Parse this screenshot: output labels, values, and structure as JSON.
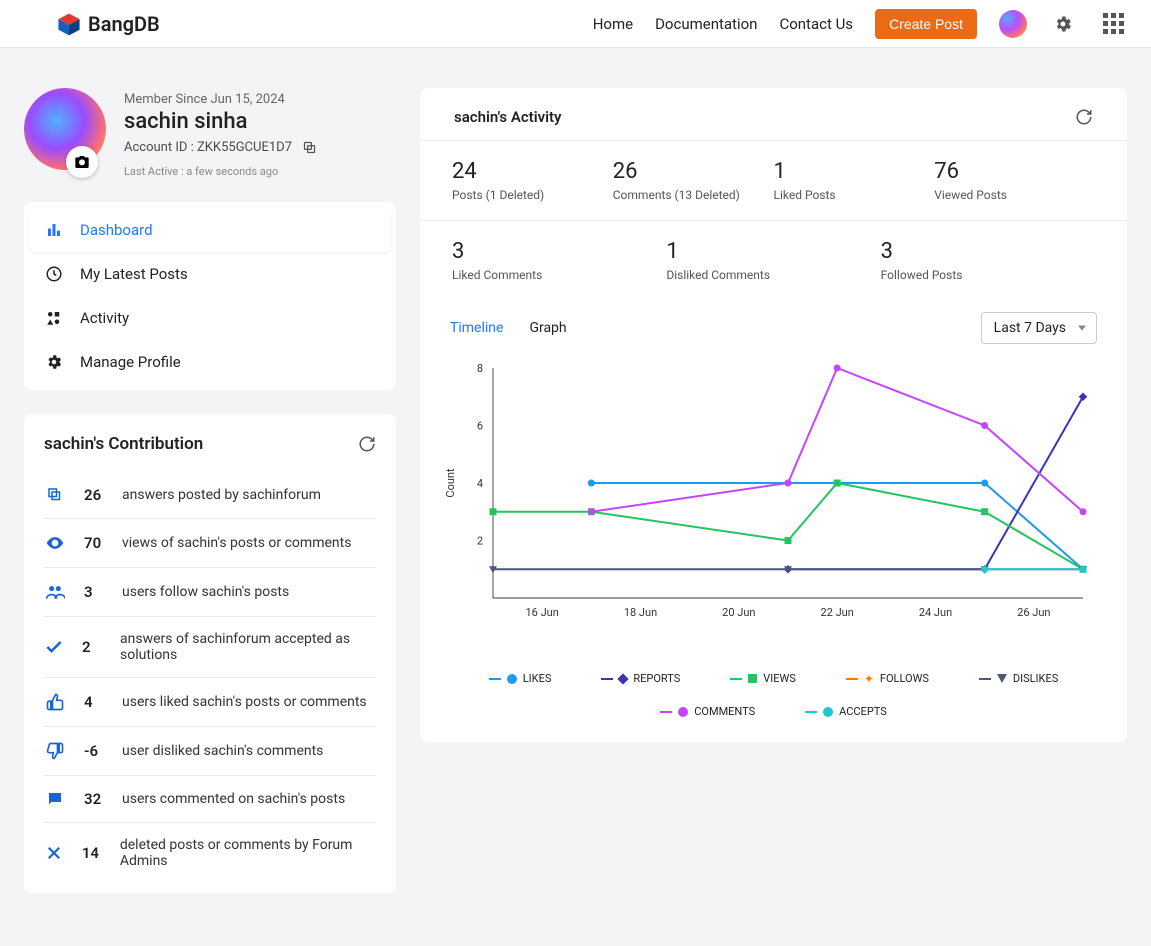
{
  "brand": "BangDB",
  "topnav": {
    "home": "Home",
    "docs": "Documentation",
    "contact": "Contact Us",
    "create": "Create Post"
  },
  "profile": {
    "member_since": "Member Since Jun 15, 2024",
    "name": "sachin sinha",
    "account_label": "Account ID : ZKK55GCUE1D7",
    "last_active": "Last Active : a few seconds ago"
  },
  "sidebar": {
    "items": [
      {
        "label": "Dashboard"
      },
      {
        "label": "My Latest Posts"
      },
      {
        "label": "Activity"
      },
      {
        "label": "Manage Profile"
      }
    ]
  },
  "contribution": {
    "title": "sachin's Contribution",
    "rows": [
      {
        "n": "26",
        "txt": "answers posted by sachinforum"
      },
      {
        "n": "70",
        "txt": "views of sachin's posts or comments"
      },
      {
        "n": "3",
        "txt": "users follow sachin's posts"
      },
      {
        "n": "2",
        "txt": "answers of sachinforum accepted as solutions"
      },
      {
        "n": "4",
        "txt": "users liked sachin's posts or comments"
      },
      {
        "n": "-6",
        "txt": "user disliked sachin's comments"
      },
      {
        "n": "32",
        "txt": "users commented on sachin's posts"
      },
      {
        "n": "14",
        "txt": "deleted posts or comments by Forum Admins"
      }
    ]
  },
  "activity": {
    "title": "sachin's Activity",
    "stats_top": [
      {
        "val": "24",
        "lbl": "Posts (1 Deleted)"
      },
      {
        "val": "26",
        "lbl": "Comments (13 Deleted)"
      },
      {
        "val": "1",
        "lbl": "Liked Posts"
      },
      {
        "val": "76",
        "lbl": "Viewed Posts"
      }
    ],
    "stats_bottom": [
      {
        "val": "3",
        "lbl": "Liked Comments"
      },
      {
        "val": "1",
        "lbl": "Disliked Comments"
      },
      {
        "val": "3",
        "lbl": "Followed Posts"
      }
    ],
    "tabs": {
      "timeline": "Timeline",
      "graph": "Graph"
    },
    "range": "Last 7 Days"
  },
  "chart_data": {
    "type": "line",
    "xlabel": "",
    "ylabel": "Count",
    "ylim": [
      0,
      8
    ],
    "x_ticks": [
      "16 Jun",
      "18 Jun",
      "20 Jun",
      "22 Jun",
      "24 Jun",
      "26 Jun"
    ],
    "series": [
      {
        "name": "LIKES",
        "color": "#1e9af0",
        "marker": "circle",
        "points": [
          {
            "x": "17 Jun",
            "y": 4
          },
          {
            "x": "21 Jun",
            "y": 4
          },
          {
            "x": "25 Jun",
            "y": 4
          },
          {
            "x": "27 Jun",
            "y": 1
          }
        ]
      },
      {
        "name": "REPORTS",
        "color": "#3a35b8",
        "marker": "diamond",
        "points": [
          {
            "x": "21 Jun",
            "y": 1
          },
          {
            "x": "25 Jun",
            "y": 1
          },
          {
            "x": "27 Jun",
            "y": 7
          }
        ]
      },
      {
        "name": "VIEWS",
        "color": "#22c55e",
        "marker": "square",
        "points": [
          {
            "x": "15 Jun",
            "y": 3
          },
          {
            "x": "17 Jun",
            "y": 3
          },
          {
            "x": "21 Jun",
            "y": 2
          },
          {
            "x": "22 Jun",
            "y": 4
          },
          {
            "x": "25 Jun",
            "y": 3
          },
          {
            "x": "27 Jun",
            "y": 1
          }
        ]
      },
      {
        "name": "FOLLOWS",
        "color": "#ff7a00",
        "marker": "star",
        "points": []
      },
      {
        "name": "DISLIKES",
        "color": "#4a577a",
        "marker": "tri-down",
        "points": [
          {
            "x": "15 Jun",
            "y": 1
          },
          {
            "x": "21 Jun",
            "y": 1
          },
          {
            "x": "25 Jun",
            "y": 1
          },
          {
            "x": "27 Jun",
            "y": 1
          }
        ]
      },
      {
        "name": "COMMENTS",
        "color": "#c544ff",
        "marker": "circle",
        "points": [
          {
            "x": "17 Jun",
            "y": 3
          },
          {
            "x": "21 Jun",
            "y": 4
          },
          {
            "x": "22 Jun",
            "y": 8
          },
          {
            "x": "25 Jun",
            "y": 6
          },
          {
            "x": "27 Jun",
            "y": 3
          }
        ]
      },
      {
        "name": "ACCEPTS",
        "color": "#1fc9c9",
        "marker": "circle",
        "points": [
          {
            "x": "25 Jun",
            "y": 1
          },
          {
            "x": "27 Jun",
            "y": 1
          }
        ]
      }
    ],
    "legend": [
      "LIKES",
      "REPORTS",
      "VIEWS",
      "FOLLOWS",
      "DISLIKES",
      "COMMENTS",
      "ACCEPTS"
    ]
  }
}
